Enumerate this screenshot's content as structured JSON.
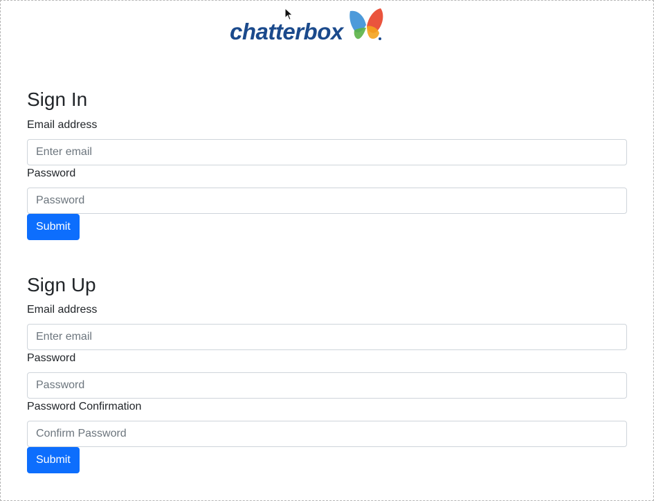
{
  "logo": {
    "text": "chatterbox",
    "colors": {
      "text": "#1b4a8c",
      "wing_red": "#e8452c",
      "wing_orange": "#f4a31e",
      "wing_green": "#5bb246",
      "wing_blue": "#3a8fd6"
    }
  },
  "sign_in": {
    "title": "Sign In",
    "email_label": "Email address",
    "email_placeholder": "Enter email",
    "email_value": "",
    "password_label": "Password",
    "password_placeholder": "Password",
    "password_value": "",
    "submit_label": "Submit"
  },
  "sign_up": {
    "title": "Sign Up",
    "email_label": "Email address",
    "email_placeholder": "Enter email",
    "email_value": "",
    "password_label": "Password",
    "password_placeholder": "Password",
    "password_value": "",
    "confirm_label": "Password Confirmation",
    "confirm_placeholder": "Confirm Password",
    "confirm_value": "",
    "submit_label": "Submit"
  },
  "theme": {
    "primary": "#0d6efd",
    "text": "#212529",
    "placeholder": "#6c757d",
    "input_border": "#ced4da",
    "frame_border": "#b5b5b5"
  }
}
